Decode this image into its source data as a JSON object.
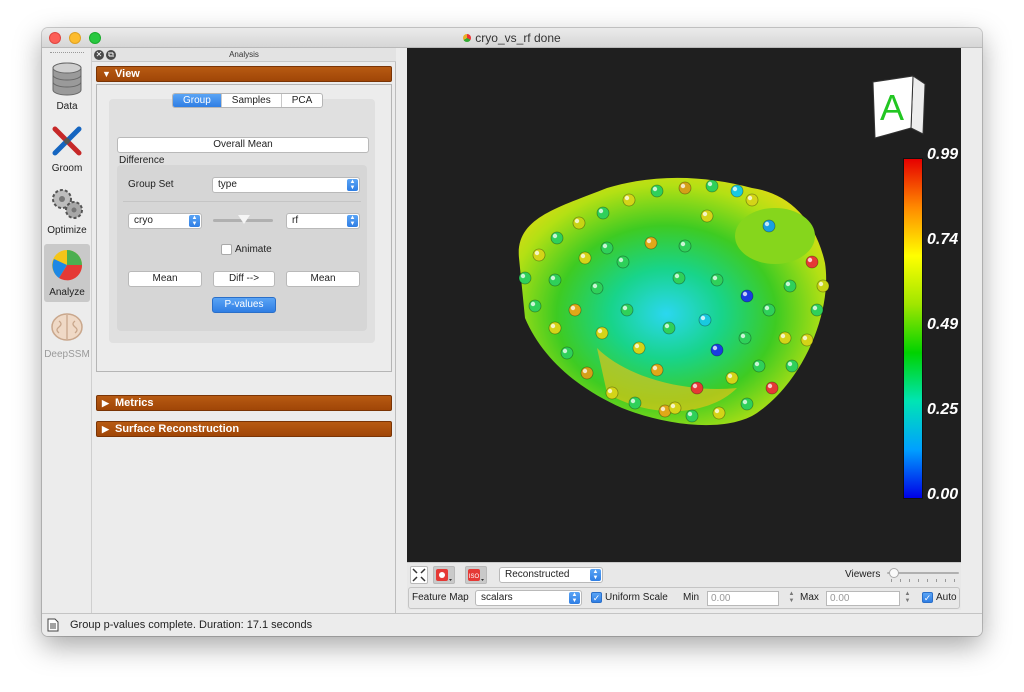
{
  "window": {
    "title": "cryo_vs_rf done"
  },
  "toolbar": {
    "items": [
      {
        "label": "Data",
        "icon": "database-icon"
      },
      {
        "label": "Groom",
        "icon": "tools-icon"
      },
      {
        "label": "Optimize",
        "icon": "gears-icon"
      },
      {
        "label": "Analyze",
        "icon": "pie-chart-icon",
        "active": true
      },
      {
        "label": "DeepSSM",
        "icon": "brain-icon",
        "disabled": true
      }
    ]
  },
  "panel": {
    "title": "Analysis",
    "sections": {
      "view": "View",
      "metrics": "Metrics",
      "surface": "Surface Reconstruction"
    },
    "tabs": [
      "Group",
      "Samples",
      "PCA"
    ],
    "overall_mean": "Overall Mean",
    "difference_label": "Difference",
    "group_set_label": "Group Set",
    "group_set_value": "type",
    "left_group": "cryo",
    "right_group": "rf",
    "animate_label": "Animate",
    "mean_left": "Mean",
    "diff_button": "Diff -->",
    "mean_right": "Mean",
    "pvalues_button": "P-values"
  },
  "viewer": {
    "orientation_letter": "A",
    "colorbar": {
      "labels": [
        "0.99",
        "0.74",
        "0.49",
        "0.25",
        "0.00"
      ]
    },
    "display_mode": "Reconstructed",
    "viewers_label": "Viewers",
    "feature_map_label": "Feature Map",
    "feature_map_value": "scalars",
    "uniform_scale_label": "Uniform Scale",
    "min_label": "Min",
    "min_placeholder": "0.00",
    "max_label": "Max",
    "max_placeholder": "0.00",
    "auto_label": "Auto"
  },
  "status": {
    "message": "Group p-values complete.  Duration: 17.1 seconds"
  },
  "colors": {
    "section_orange": "#a84b0a",
    "accent_blue": "#2f7ee4"
  }
}
